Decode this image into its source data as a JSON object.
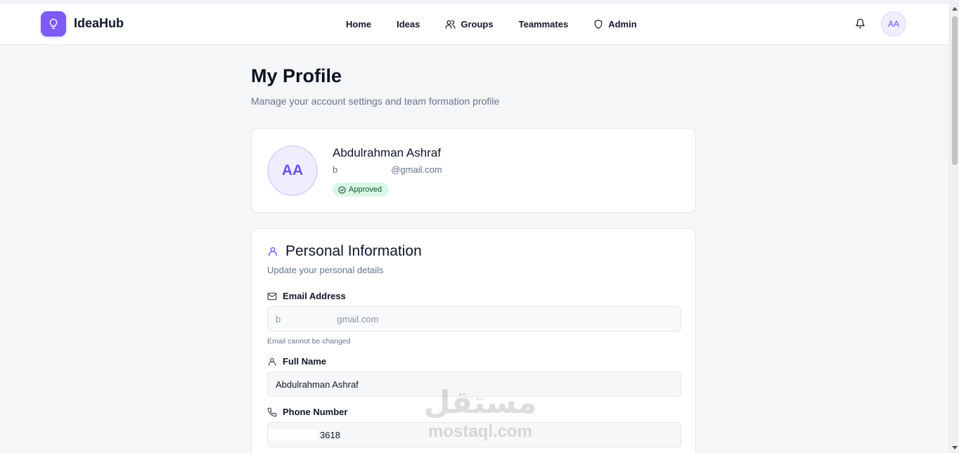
{
  "app": {
    "name": "IdeaHub",
    "logo_icon": "lightbulb-icon",
    "accent_color": "#7c5cf5"
  },
  "nav": {
    "items": [
      {
        "label": "Home",
        "icon": null
      },
      {
        "label": "Ideas",
        "icon": null
      },
      {
        "label": "Groups",
        "icon": "users-icon"
      },
      {
        "label": "Teammates",
        "icon": null
      },
      {
        "label": "Admin",
        "icon": "shield-icon"
      }
    ],
    "notifications_icon": "bell-icon",
    "user_initials": "AA"
  },
  "page": {
    "title": "My Profile",
    "subtitle": "Manage your account settings and team formation profile"
  },
  "profile": {
    "initials": "AA",
    "name": "Abdulrahman Ashraf",
    "email_prefix": "b",
    "email_suffix": "@gmail.com",
    "status": "Approved",
    "status_color": "#d9f7e6"
  },
  "personal_info": {
    "title": "Personal Information",
    "subtitle": "Update your personal details",
    "email": {
      "label": "Email Address",
      "value_prefix": "b",
      "value_suffix": "gmail.com",
      "hint": "Email cannot be changed"
    },
    "full_name": {
      "label": "Full Name",
      "value": "Abdulrahman Ashraf"
    },
    "phone": {
      "label": "Phone Number",
      "value": "3618"
    }
  },
  "watermark": {
    "arabic": "مستقل",
    "latin": "mostaql.com"
  }
}
